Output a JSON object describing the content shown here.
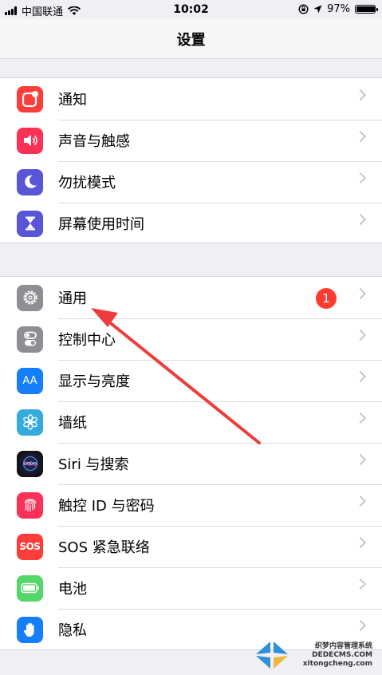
{
  "status_bar": {
    "carrier": "中国联通",
    "time": "10:02",
    "battery_percent": "97%",
    "battery_level": 0.97
  },
  "nav": {
    "title": "设置"
  },
  "group1": [
    {
      "label": "通知",
      "icon": "notifications-icon",
      "color": "#fc3d39"
    },
    {
      "label": "声音与触感",
      "icon": "sound-icon",
      "color": "#fc3158"
    },
    {
      "label": "勿扰模式",
      "icon": "moon-icon",
      "color": "#5856d6"
    },
    {
      "label": "屏幕使用时间",
      "icon": "hourglass-icon",
      "color": "#5856d6"
    }
  ],
  "group2": [
    {
      "label": "通用",
      "icon": "gear-icon",
      "color": "#8e8e93",
      "badge": "1"
    },
    {
      "label": "控制中心",
      "icon": "toggles-icon",
      "color": "#8e8e93"
    },
    {
      "label": "显示与亮度",
      "icon": "display-icon",
      "color": "#147efb",
      "icon_text": "AA"
    },
    {
      "label": "墙纸",
      "icon": "flower-icon",
      "color": "#35aadc"
    },
    {
      "label": "Siri 与搜索",
      "icon": "siri-icon",
      "color": "#222222"
    },
    {
      "label": "触控 ID 与密码",
      "icon": "fingerprint-icon",
      "color": "#fc3158"
    },
    {
      "label": "SOS 紧急联络",
      "icon": "sos-icon",
      "color": "#fc3d39",
      "icon_text": "SOS"
    },
    {
      "label": "电池",
      "icon": "battery-icon",
      "color": "#53d769"
    },
    {
      "label": "隐私",
      "icon": "hand-icon",
      "color": "#147efb"
    }
  ],
  "watermark": {
    "line1": "织梦内容管理系统",
    "line2": "DEDECMS.COM",
    "line3": "xitongcheng.com"
  },
  "colors": {
    "annotation_arrow": "#ef3b3b",
    "chevron": "#c7c7cc",
    "badge": "#ff3b30"
  }
}
